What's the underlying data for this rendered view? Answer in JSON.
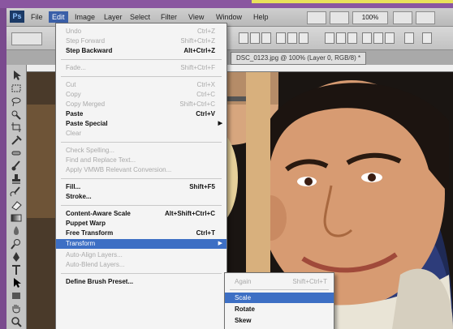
{
  "app": {
    "logo_text": "Ps",
    "colors": {
      "menu_highlight": "#3d6fc4",
      "frame_purple": "#8a56a0",
      "frame_yellow": "#e9e15a"
    }
  },
  "menubar": {
    "items": [
      "File",
      "Edit",
      "Image",
      "Layer",
      "Select",
      "Filter",
      "View",
      "Window",
      "Help"
    ],
    "zoom": "100%"
  },
  "document_tab": {
    "title": "DSC_0123.jpg @ 100% (Layer 0, RGB/8) *"
  },
  "edit_menu": {
    "items": [
      {
        "label": "Undo",
        "shortcut": "Ctrl+Z",
        "state": "disabled"
      },
      {
        "label": "Step Forward",
        "shortcut": "Shift+Ctrl+Z",
        "state": "disabled"
      },
      {
        "label": "Step Backward",
        "shortcut": "Alt+Ctrl+Z",
        "state": "enabled"
      },
      {
        "label": "Fade...",
        "shortcut": "Shift+Ctrl+F",
        "state": "disabled"
      },
      {
        "label": "Cut",
        "shortcut": "Ctrl+X",
        "state": "disabled"
      },
      {
        "label": "Copy",
        "shortcut": "Ctrl+C",
        "state": "disabled"
      },
      {
        "label": "Copy Merged",
        "shortcut": "Shift+Ctrl+C",
        "state": "disabled"
      },
      {
        "label": "Paste",
        "shortcut": "Ctrl+V",
        "state": "enabled"
      },
      {
        "label": "Paste Special",
        "shortcut": "",
        "state": "enabled",
        "submenu": true
      },
      {
        "label": "Clear",
        "shortcut": "",
        "state": "disabled"
      },
      {
        "label": "Check Spelling...",
        "shortcut": "",
        "state": "disabled"
      },
      {
        "label": "Find and Replace Text...",
        "shortcut": "",
        "state": "disabled"
      },
      {
        "label": "Apply VMWB Relevant Conversion...",
        "shortcut": "",
        "state": "disabled"
      },
      {
        "label": "Fill...",
        "shortcut": "Shift+F5",
        "state": "enabled"
      },
      {
        "label": "Stroke...",
        "shortcut": "",
        "state": "enabled"
      },
      {
        "label": "Content-Aware Scale",
        "shortcut": "Alt+Shift+Ctrl+C",
        "state": "enabled"
      },
      {
        "label": "Puppet Warp",
        "shortcut": "",
        "state": "enabled"
      },
      {
        "label": "Free Transform",
        "shortcut": "Ctrl+T",
        "state": "enabled"
      },
      {
        "label": "Transform",
        "shortcut": "",
        "state": "highlighted",
        "submenu": true
      },
      {
        "label": "Auto-Align Layers...",
        "shortcut": "",
        "state": "disabled"
      },
      {
        "label": "Auto-Blend Layers...",
        "shortcut": "",
        "state": "disabled"
      },
      {
        "label": "Define Brush Preset...",
        "shortcut": "",
        "state": "enabled"
      }
    ]
  },
  "transform_submenu": {
    "items": [
      {
        "label": "Again",
        "shortcut": "Shift+Ctrl+T",
        "state": "disabled"
      },
      {
        "label": "Scale",
        "shortcut": "",
        "state": "highlighted"
      },
      {
        "label": "Rotate",
        "shortcut": "",
        "state": "enabled"
      },
      {
        "label": "Skew",
        "shortcut": "",
        "state": "enabled"
      }
    ]
  },
  "toolbox": {
    "tools": [
      "move-tool",
      "marquee-tool",
      "lasso-tool",
      "quick-select-tool",
      "crop-tool",
      "eyedropper-tool",
      "healing-brush-tool",
      "brush-tool",
      "clone-stamp-tool",
      "history-brush-tool",
      "eraser-tool",
      "gradient-tool",
      "blur-tool",
      "dodge-tool",
      "pen-tool",
      "type-tool",
      "path-select-tool",
      "shape-tool",
      "hand-tool",
      "zoom-tool"
    ]
  }
}
